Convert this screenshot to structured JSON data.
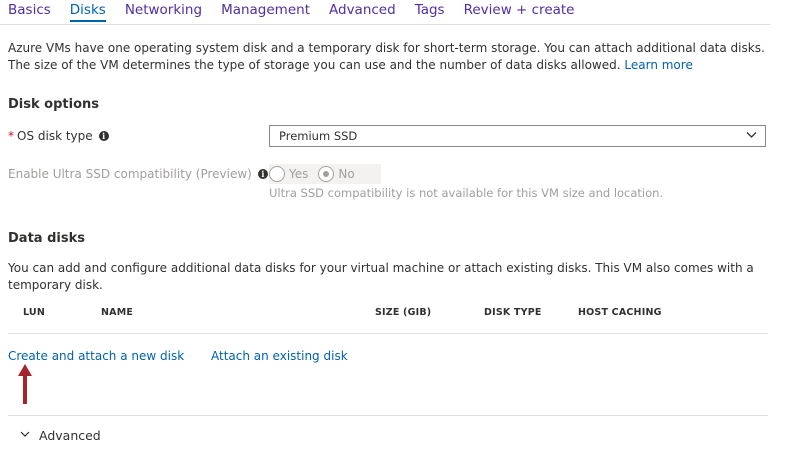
{
  "tabs": [
    {
      "label": "Basics"
    },
    {
      "label": "Disks"
    },
    {
      "label": "Networking"
    },
    {
      "label": "Management"
    },
    {
      "label": "Advanced"
    },
    {
      "label": "Tags"
    },
    {
      "label": "Review + create"
    }
  ],
  "active_tab": "Disks",
  "intro": {
    "text": "Azure VMs have one operating system disk and a temporary disk for short-term storage. You can attach additional data disks. The size of the VM determines the type of storage you can use and the number of data disks allowed.",
    "learn_more": "Learn more"
  },
  "disk_options": {
    "title": "Disk options",
    "os_disk_type": {
      "required_mark": "*",
      "label": "OS disk type",
      "value": "Premium SSD"
    },
    "ultra_ssd": {
      "label": "Enable Ultra SSD compatibility (Preview)",
      "options": [
        "Yes",
        "No"
      ],
      "selected": "No",
      "helper": "Ultra SSD compatibility is not available for this VM size and location."
    }
  },
  "data_disks": {
    "title": "Data disks",
    "description": "You can add and configure additional data disks for your virtual machine or attach existing disks. This VM also comes with a temporary disk.",
    "columns": [
      "LUN",
      "NAME",
      "SIZE (GIB)",
      "DISK TYPE",
      "HOST CACHING"
    ],
    "create_link": "Create and attach a new disk",
    "attach_link": "Attach an existing disk"
  },
  "advanced": {
    "label": "Advanced"
  },
  "colors": {
    "link": "#0062ad",
    "tab_inactive": "#4f2fa3",
    "required": "#c50f1f",
    "annotation_arrow": "#a4262c"
  }
}
